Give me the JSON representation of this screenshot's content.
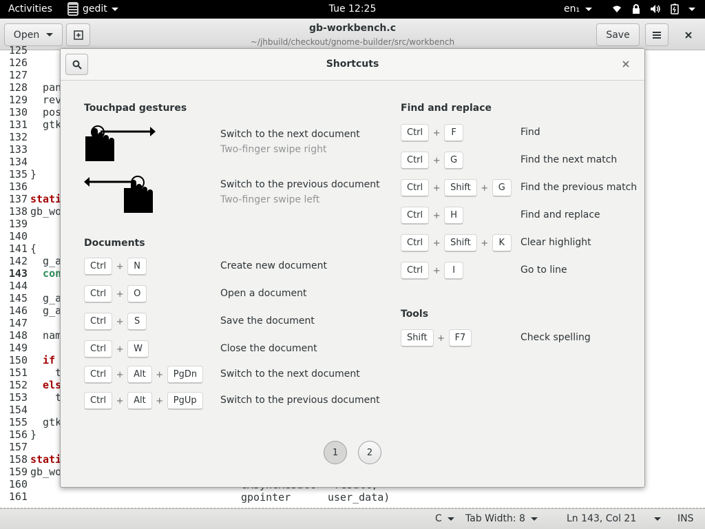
{
  "topbar": {
    "activities": "Activities",
    "app_name": "gedit",
    "clock": "Tue 12:25",
    "input_lang": "en₁"
  },
  "headerbar": {
    "open_label": "Open",
    "title": "gb-workbench.c",
    "subtitle": "~/jhbuild/checkout/gnome-builder/src/workbench",
    "save_label": "Save"
  },
  "editor": {
    "lines": [
      {
        "n": "125",
        "t": ""
      },
      {
        "n": "126",
        "t": ""
      },
      {
        "n": "127",
        "t": ""
      },
      {
        "n": "128",
        "t": "  pan"
      },
      {
        "n": "129",
        "t": "  rev"
      },
      {
        "n": "130",
        "t": "  pos"
      },
      {
        "n": "131",
        "t": "  gtk"
      },
      {
        "n": "132",
        "t": ""
      },
      {
        "n": "133",
        "t": ""
      },
      {
        "n": "134",
        "t": ""
      },
      {
        "n": "135",
        "t": "}"
      },
      {
        "n": "136",
        "t": ""
      },
      {
        "n": "137",
        "t": "stati"
      },
      {
        "n": "138",
        "t": "gb_wo"
      },
      {
        "n": "139",
        "t": ""
      },
      {
        "n": "140",
        "t": ""
      },
      {
        "n": "141",
        "t": "{"
      },
      {
        "n": "142",
        "t": "  g_a"
      },
      {
        "n": "143",
        "t": "  con"
      },
      {
        "n": "144",
        "t": ""
      },
      {
        "n": "145",
        "t": "  g_a"
      },
      {
        "n": "146",
        "t": "  g_a"
      },
      {
        "n": "147",
        "t": ""
      },
      {
        "n": "148",
        "t": "  nam"
      },
      {
        "n": "149",
        "t": ""
      },
      {
        "n": "150",
        "t": "  if"
      },
      {
        "n": "151",
        "t": "    t"
      },
      {
        "n": "152",
        "t": "  els"
      },
      {
        "n": "153",
        "t": "    t"
      },
      {
        "n": "154",
        "t": ""
      },
      {
        "n": "155",
        "t": "  gtk"
      },
      {
        "n": "156",
        "t": "}"
      },
      {
        "n": "157",
        "t": ""
      },
      {
        "n": "158",
        "t": "stati"
      },
      {
        "n": "159",
        "t": "gb_wo"
      },
      {
        "n": "160",
        "t": ""
      },
      {
        "n": "161",
        "t": ""
      }
    ],
    "tail_160": "GAsyncResult  *result,",
    "tail_161_a": "gpointer",
    "tail_161_b": "user_data)"
  },
  "statusbar": {
    "language": "C",
    "tab_width": "Tab Width: 8",
    "position": "Ln 143, Col 21",
    "mode": "INS"
  },
  "dialog": {
    "title": "Shortcuts",
    "touchpad": {
      "title": "Touchpad gestures",
      "items": [
        {
          "label": "Switch to the next document",
          "sub": "Two-finger swipe right"
        },
        {
          "label": "Switch to the previous document",
          "sub": "Two-finger swipe left"
        }
      ]
    },
    "documents": {
      "title": "Documents",
      "items": [
        {
          "keys": [
            "Ctrl",
            "N"
          ],
          "label": "Create new document"
        },
        {
          "keys": [
            "Ctrl",
            "O"
          ],
          "label": "Open a document"
        },
        {
          "keys": [
            "Ctrl",
            "S"
          ],
          "label": "Save the document"
        },
        {
          "keys": [
            "Ctrl",
            "W"
          ],
          "label": "Close the document"
        },
        {
          "keys": [
            "Ctrl",
            "Alt",
            "PgDn"
          ],
          "label": "Switch to the next document"
        },
        {
          "keys": [
            "Ctrl",
            "Alt",
            "PgUp"
          ],
          "label": "Switch to the previous document"
        }
      ]
    },
    "find": {
      "title": "Find and replace",
      "items": [
        {
          "keys": [
            "Ctrl",
            "F"
          ],
          "label": "Find"
        },
        {
          "keys": [
            "Ctrl",
            "G"
          ],
          "label": "Find the next match"
        },
        {
          "keys": [
            "Ctrl",
            "Shift",
            "G"
          ],
          "label": "Find the previous match"
        },
        {
          "keys": [
            "Ctrl",
            "H"
          ],
          "label": "Find and replace"
        },
        {
          "keys": [
            "Ctrl",
            "Shift",
            "K"
          ],
          "label": "Clear highlight"
        },
        {
          "keys": [
            "Ctrl",
            "I"
          ],
          "label": "Go to line"
        }
      ]
    },
    "tools": {
      "title": "Tools",
      "items": [
        {
          "keys": [
            "Shift",
            "F7"
          ],
          "label": "Check spelling"
        }
      ]
    },
    "pages": [
      "1",
      "2"
    ],
    "plus_sign": "+"
  }
}
